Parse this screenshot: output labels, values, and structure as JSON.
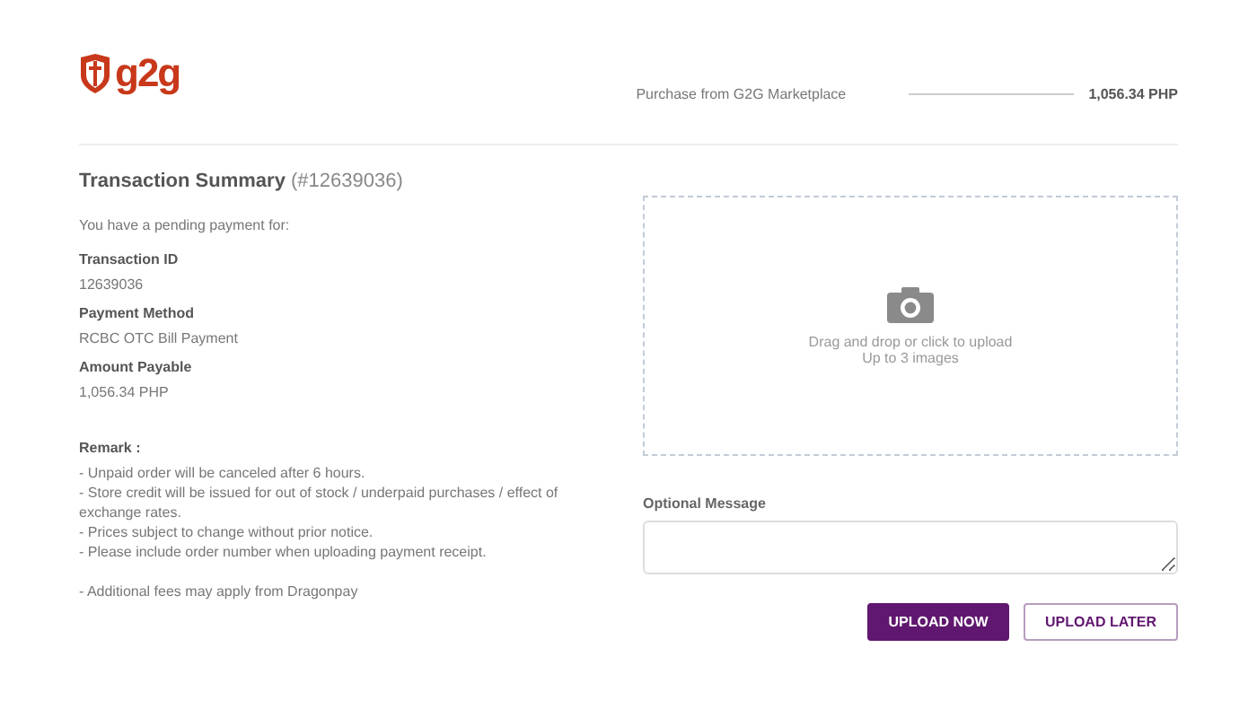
{
  "header": {
    "logo_text": "g2g",
    "purchase_label": "Purchase from G2G Marketplace",
    "purchase_amount": "1,056.34 PHP"
  },
  "summary": {
    "title": "Transaction Summary",
    "number": "(#12639036)",
    "intro": "You have a pending payment for:",
    "fields": [
      {
        "label": "Transaction ID",
        "value": "12639036"
      },
      {
        "label": "Payment Method",
        "value": "RCBC OTC Bill Payment"
      },
      {
        "label": "Amount Payable",
        "value": "1,056.34 PHP"
      }
    ],
    "remark_title": "Remark :",
    "remarks": [
      "- Unpaid order will be canceled after 6 hours.",
      "- Store credit will be issued for out of stock / underpaid purchases / effect of exchange rates.",
      "- Prices subject to change without prior notice.",
      "- Please include order number when uploading payment receipt."
    ],
    "footnote": "- Additional fees may apply from Dragonpay"
  },
  "upload": {
    "drop_text": "Drag and drop or click to upload",
    "drop_limit": "Up to 3 images",
    "message_label": "Optional Message",
    "buttons": [
      {
        "label": "UPLOAD NOW",
        "kind": "primary"
      },
      {
        "label": "UPLOAD LATER",
        "kind": "secondary"
      }
    ]
  }
}
